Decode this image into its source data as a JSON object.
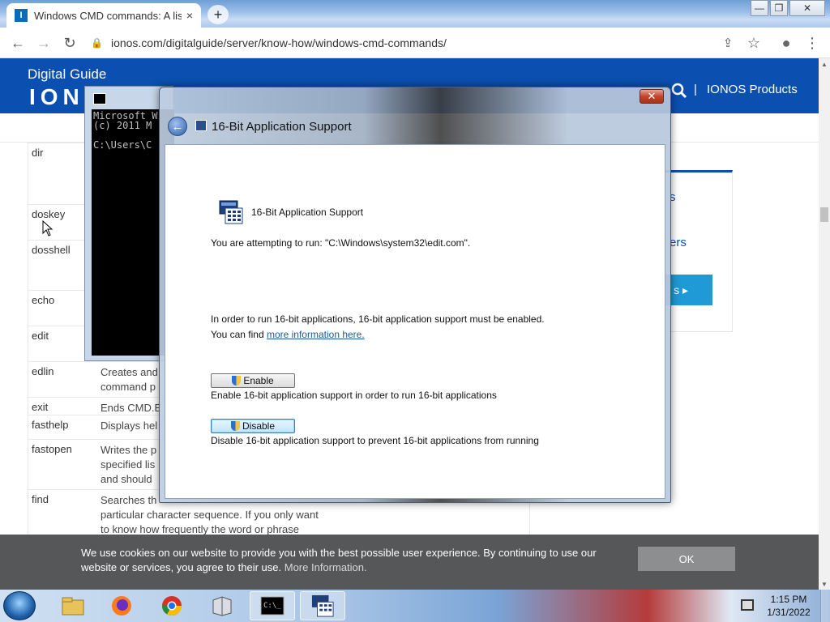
{
  "browser": {
    "tab_title": "Windows CMD commands: A list",
    "tab_favicon_letter": "I",
    "tab_close": "×",
    "new_tab": "+",
    "window_controls": {
      "minimize": "—",
      "maximize": "❐",
      "close": "✕"
    },
    "nav": {
      "back": "←",
      "forward": "→",
      "reload": "↻"
    },
    "url": "ionos.com/digitalguide/server/know-how/windows-cmd-commands/",
    "toolbar_icons": {
      "share": "⇪",
      "star": "☆",
      "profile": "●",
      "menu": "⋮"
    }
  },
  "header": {
    "title": "Digital Guide",
    "logo": "IONOS",
    "search_glyph": "🔍",
    "separator": "|",
    "products_link": "IONOS Products"
  },
  "commands": [
    {
      "name": "dir",
      "desc": ""
    },
    {
      "name": "doskey",
      "desc": ""
    },
    {
      "name": "dosshell",
      "desc": ""
    },
    {
      "name": "echo",
      "desc": ""
    },
    {
      "name": "edit",
      "desc": ""
    },
    {
      "name": "edlin",
      "desc": "Creates and\ncommand p"
    },
    {
      "name": "exit",
      "desc": "Ends CMD.E"
    },
    {
      "name": "fasthelp",
      "desc": "Displays hel"
    },
    {
      "name": "fastopen",
      "desc": "Writes the p\nspecified lis\nand should"
    },
    {
      "name": "find",
      "desc": "Searches th\nparticular character sequence. If you only want\nto know how frequently the word or phrase"
    }
  ],
  "sidebar": {
    "text_1": "s",
    "text_2": "ers",
    "button_arrow": "s ▸"
  },
  "cookie": {
    "text": "We use cookies on our website to provide you with the best possible user experience. By continuing to use our website or services, you agree to their use.",
    "more_link": "More Information.",
    "ok_button": "OK"
  },
  "cmd_window": {
    "text": "Microsoft W\n(c) 2011 M\n\nC:\\Users\\C"
  },
  "dialog": {
    "title": "16-Bit Application Support",
    "close": "✕",
    "back": "←",
    "app_title": "16-Bit Application Support",
    "run_text": "You are attempting to run: \"C:\\Windows\\system32\\edit.com\".",
    "info_line_1": "In order to run 16-bit applications, 16-bit application support must be enabled.",
    "info_line_2_prefix": "You can find ",
    "info_link": "more information here.",
    "enable_button": "Enable",
    "enable_desc": "Enable 16-bit application support in order to run 16-bit applications",
    "disable_button": "Disable",
    "disable_desc": "Disable 16-bit application support to prevent 16-bit applications from running"
  },
  "taskbar": {
    "items": [
      "explorer",
      "firefox",
      "chrome",
      "app",
      "cmd",
      "16-bit-support"
    ],
    "clock_time": "1:15 PM",
    "clock_date": "1/31/2022"
  },
  "colors": {
    "brand_blue": "#0b4fb0",
    "cookie_bg": "#555759",
    "link_blue": "#1a5aa6"
  }
}
